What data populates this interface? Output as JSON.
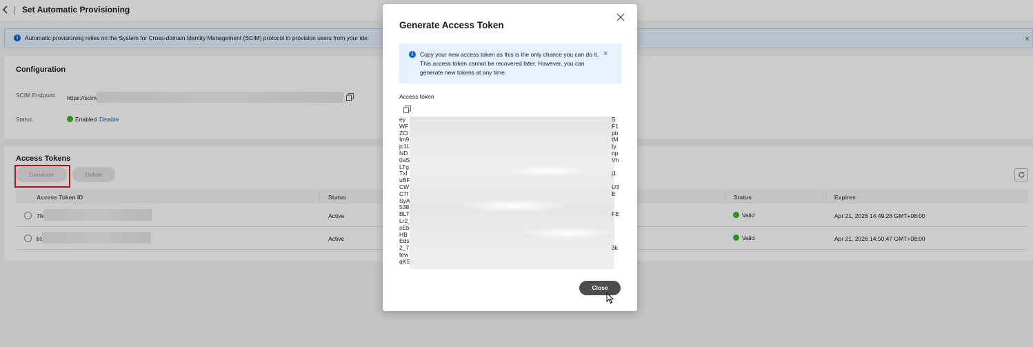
{
  "page": {
    "title": "Set Automatic Provisioning"
  },
  "banner": {
    "text": "Automatic provisioning relies on the System for Cross-domain Identity Management (SCIM) protocol to provision users from your ide",
    "close": "×"
  },
  "configuration": {
    "title": "Configuration",
    "scim_label": "SCIM Endpoint",
    "scim_value": "https://scim",
    "status_label": "Status",
    "status_value": "Enabled",
    "disable_link": "Disable"
  },
  "tokens": {
    "title": "Access Tokens",
    "generate_label": "Generate",
    "delete_label": "Delete",
    "columns": [
      "Access Token ID",
      "Status",
      "Status",
      "Expires"
    ],
    "rows": [
      {
        "id": "7fe",
        "status": "Active",
        "valid": "Valid",
        "expires": "Apr 21, 2026 14:49:28 GMT+08:00"
      },
      {
        "id": "b3",
        "status": "Active",
        "valid": "Valid",
        "expires": "Apr 21, 2026 14:50:47 GMT+08:00"
      }
    ]
  },
  "modal": {
    "title": "Generate Access Token",
    "notice": "Copy your new access token as this is the only chance you can do it. This access token cannot be recovered later. However, you can generate new tokens at any time.",
    "notice_close": "×",
    "token_label": "Access token",
    "token_left": [
      "ey",
      "WF",
      "ZCI",
      "Im9",
      "jc1L",
      "ND",
      "0aS",
      "LTg",
      "Txl",
      "uBF",
      "CW",
      "C7f",
      "SyA",
      "538",
      "BLT",
      "Lr2_",
      "sEb",
      "HB",
      "Eds",
      "2_7",
      "tew",
      "qKS"
    ],
    "token_right": [
      "S",
      "F1",
      "pb",
      "tM",
      "ty",
      "np",
      "Vh",
      "",
      "j1",
      "",
      "U3",
      "E",
      "",
      "",
      "FE",
      "",
      "",
      "",
      "",
      "3k",
      "",
      ""
    ],
    "close_label": "Close"
  }
}
